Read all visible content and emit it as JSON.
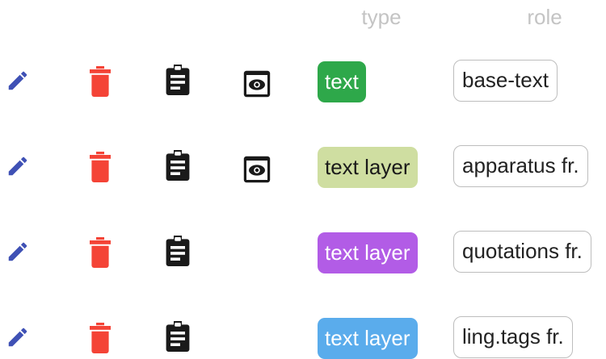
{
  "header": {
    "type_label": "type",
    "role_label": "role"
  },
  "rows": [
    {
      "type": {
        "label": "text",
        "bg": "#2ea84a",
        "fg": "#ffffff"
      },
      "role": "base-text",
      "has_preview": true
    },
    {
      "type": {
        "label": "text layer",
        "bg": "#cfdea1",
        "fg": "#1a1a1a"
      },
      "role": "apparatus fr.",
      "has_preview": true
    },
    {
      "type": {
        "label": "text layer",
        "bg": "#b25ce6",
        "fg": "#ffffff"
      },
      "role": "quotations fr.",
      "has_preview": false
    },
    {
      "type": {
        "label": "text layer",
        "bg": "#5aacec",
        "fg": "#ffffff"
      },
      "role": "ling.tags fr.",
      "has_preview": false
    }
  ],
  "icons": {
    "edit": {
      "name": "pencil-icon",
      "color": "#3f51b5"
    },
    "delete": {
      "name": "trash-icon",
      "color": "#f44336"
    },
    "clipboard": {
      "name": "clipboard-icon",
      "color": "#1a1a1a"
    },
    "preview": {
      "name": "eye-preview-icon",
      "color": "#1a1a1a"
    }
  }
}
